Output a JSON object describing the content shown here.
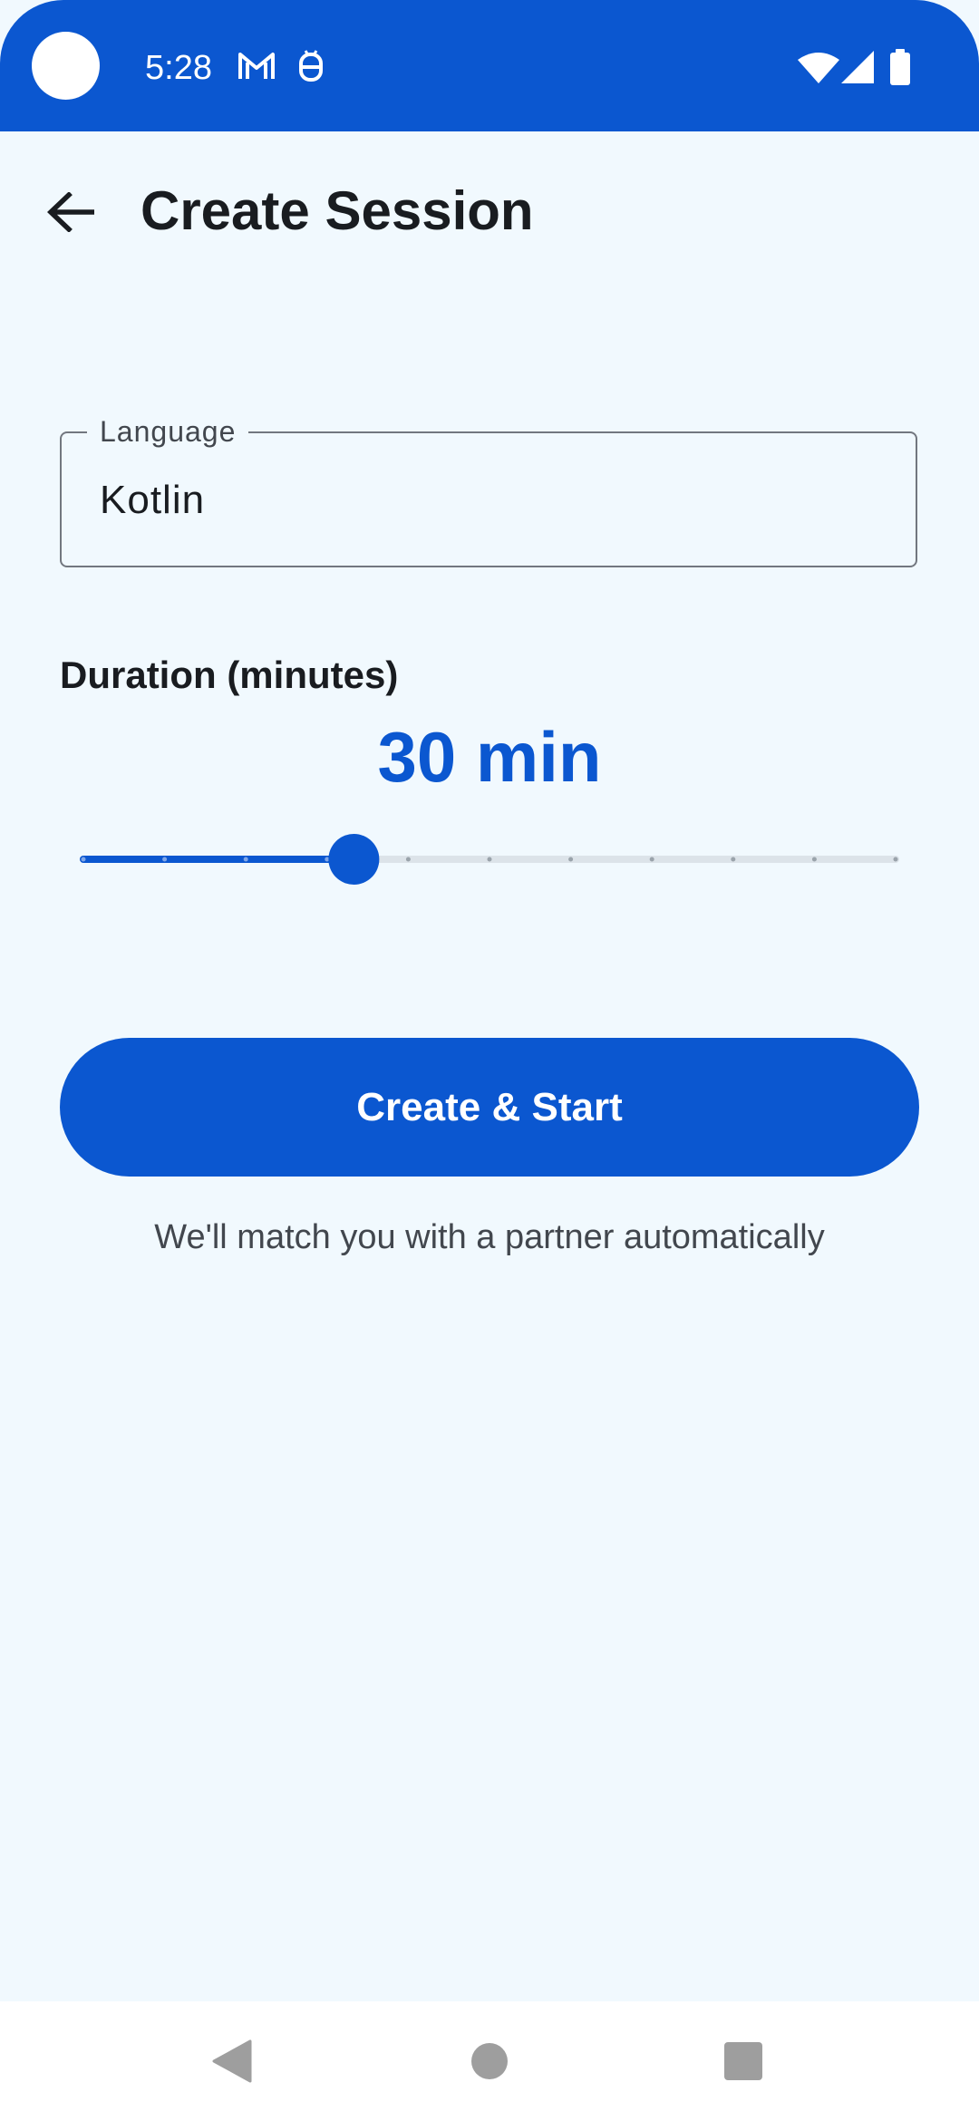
{
  "status_bar": {
    "time": "5:28",
    "left_icons": [
      "gmail-icon",
      "debug-icon"
    ],
    "right_icons": [
      "wifi-icon",
      "signal-icon",
      "battery-icon"
    ],
    "background_color": "#0B57D0"
  },
  "app_bar": {
    "title": "Create Session",
    "back_icon": "arrow-back-icon"
  },
  "language_field": {
    "label": "Language",
    "value": "Kotlin"
  },
  "duration": {
    "label": "Duration (minutes)",
    "value_text": "30 min",
    "slider": {
      "value_fraction": 0.333,
      "steps": 10,
      "active_color": "#0B57D0",
      "inactive_color": "#DCE3E9"
    }
  },
  "primary_action": {
    "label": "Create & Start"
  },
  "hint": "We'll match you with a partner automatically",
  "nav_bar": {
    "icons": [
      "nav-back-icon",
      "nav-home-icon",
      "nav-recents-icon"
    ]
  },
  "colors": {
    "accent": "#0B57D0",
    "background": "#F1F9FE",
    "on_surface": "#191C20"
  }
}
